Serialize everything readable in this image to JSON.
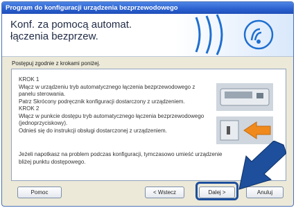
{
  "window": {
    "title": "Program do konfiguracji urządzenia bezprzewodowego"
  },
  "header": {
    "title": "Konf. za pomocą automat. łączenia bezprzew."
  },
  "instruction": "Postępuj zgodnie z krokami poniżej.",
  "steps_text": "KROK 1\nWłącz w urządzeniu tryb automatycznego łączenia bezprzewodowego z panelu sterowania.\nPatrz Skrócony podręcznik konfiguracji dostarczony z urządzeniem.\nKROK 2\nWłącz w punkcie dostępu tryb automatycznego łączenia bezprzewodowego (jednoprzyciskowy).\nOdnieś się do instrukcji obsługi dostarczonej z urządzeniem.",
  "note": "Jeżeli napotkasz na problem podczas konfiguracji, tymczasowo umieść urządzenie bliżej punktu dostępowego.",
  "buttons": {
    "help": "Pomoc",
    "back": "< Wstecz",
    "next": "Dalej >",
    "cancel": "Anuluj"
  },
  "colors": {
    "accent": "#1d4f9c",
    "title_bar": "#2a5fcf",
    "wave": "#1e6fd0"
  }
}
